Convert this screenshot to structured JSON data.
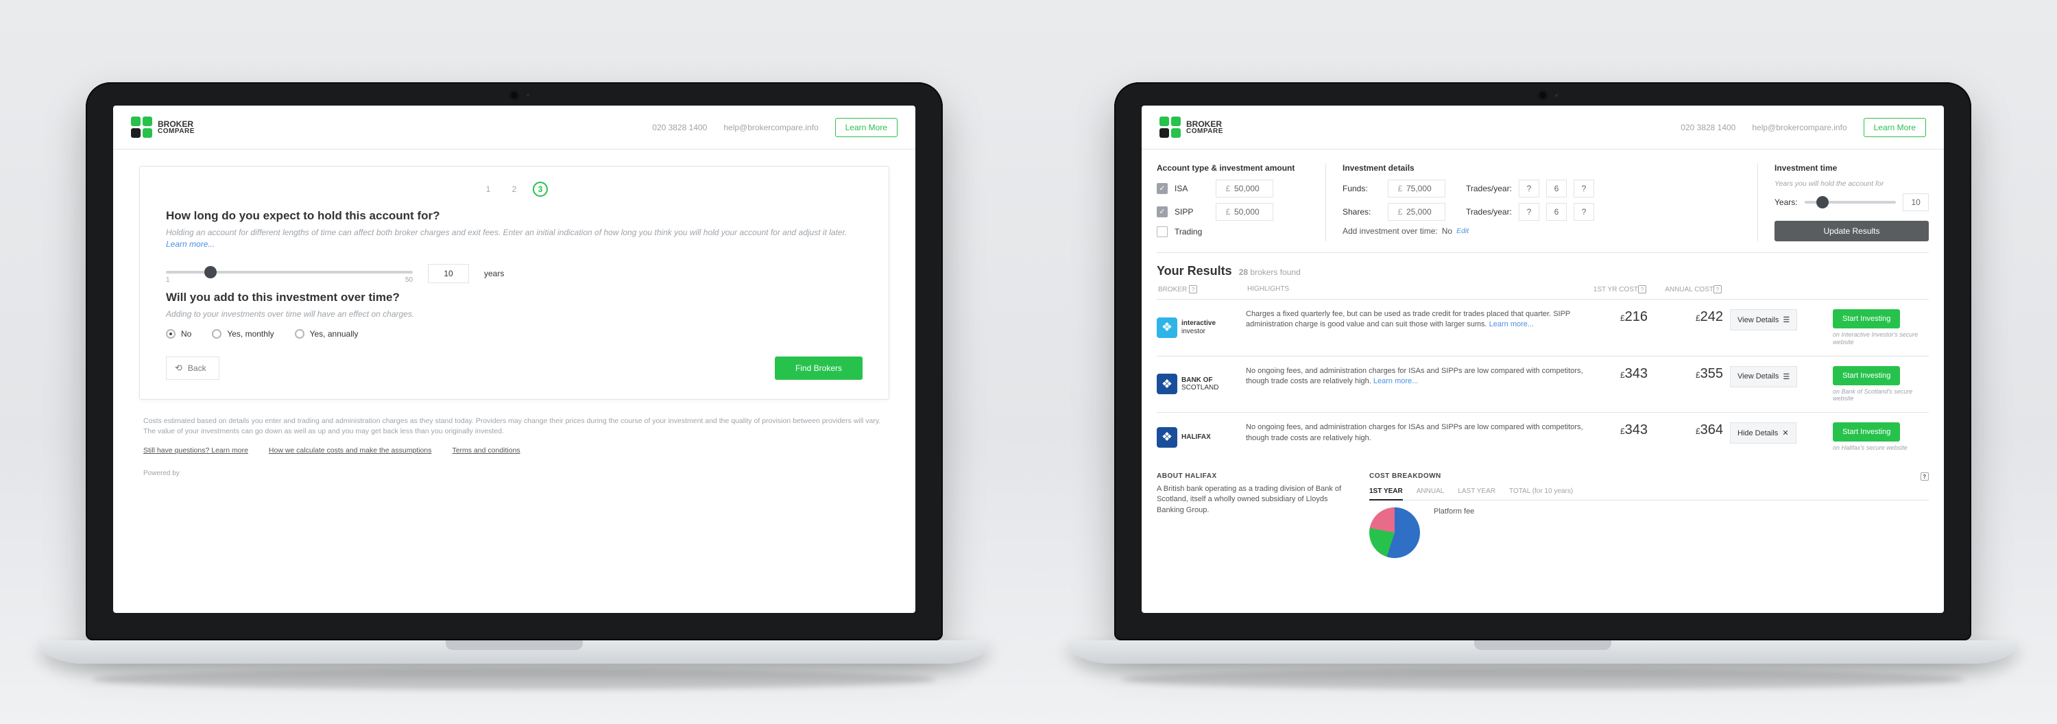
{
  "brand": {
    "line1": "BROKER",
    "line2": "COMPARE"
  },
  "header": {
    "phone": "020 3828 1400",
    "email": "help@brokercompare.info",
    "learn": "Learn More"
  },
  "wizard": {
    "steps": [
      "1",
      "2",
      "3"
    ],
    "active_step": "3",
    "q1_title": "How long do you expect to hold this account for?",
    "q1_sub": "Holding an account for different lengths of time can affect both broker charges and exit fees. Enter an initial indication of how long you think you will hold your account for and adjust it later.",
    "learn_more": "Learn more...",
    "slider_min": "1",
    "slider_max": "50",
    "years_value": "10",
    "years_unit": "years",
    "q2_title": "Will you add to this investment over time?",
    "q2_sub": "Adding to your investments over time will have an effect on charges.",
    "radios": {
      "no": "No",
      "monthly": "Yes, monthly",
      "annually": "Yes, annually",
      "selected": "no"
    },
    "back": "Back",
    "submit": "Find Brokers",
    "disclaimer": "Costs estimated based on details you enter and trading and administration charges as they stand today. Providers may change their prices during the course of your investment and the quality of provision between providers will vary. The value of your investments can go down as well as up and you may get back less than you originally invested.",
    "links": {
      "faq": "Still have questions? Learn more",
      "calc": "How we calculate costs and make the assumptions",
      "terms": "Terms and conditions"
    },
    "powered": "Powered by"
  },
  "filters": {
    "col1_head": "Account type & investment amount",
    "isa_label": "ISA",
    "isa_val": "50,000",
    "sipp_label": "SIPP",
    "sipp_val": "50,000",
    "trading_label": "Trading",
    "currency": "£",
    "col2_head": "Investment details",
    "funds_label": "Funds:",
    "funds_val": "75,000",
    "trades_label": "Trades/year:",
    "funds_t1": "?",
    "funds_t2": "6",
    "funds_t3": "?",
    "shares_label": "Shares:",
    "shares_val": "25,000",
    "shares_t1": "?",
    "shares_t2": "6",
    "shares_t3": "?",
    "add_over_time": "Add investment over time:",
    "add_val": "No",
    "edit": "Edit",
    "col3_head": "Investment time",
    "col3_sub": "Years you will hold the account for",
    "years_label": "Years:",
    "years_val": "10",
    "update": "Update Results"
  },
  "results": {
    "title": "Your Results",
    "count_n": "28",
    "count_label": "brokers found",
    "cols": {
      "broker": "BROKER",
      "high": "HIGHLIGHTS",
      "first": "1ST YR COST",
      "annual": "ANNUAL COST"
    },
    "rows": [
      {
        "name_l1": "interactive",
        "name_l2": "investor",
        "icon_color": "#2fb4e8",
        "blurb": "Charges a fixed quarterly fee, but can be used as trade credit for trades placed that quarter. SIPP administration charge is good value and can suit those with larger sums.",
        "learn": "Learn more...",
        "first": "216",
        "annual": "242",
        "view": "View Details",
        "view_mode": "view",
        "start": "Start Investing",
        "secure": "on Interactive Investor's secure website"
      },
      {
        "name_l1": "BANK OF",
        "name_l2": "SCOTLAND",
        "icon_color": "#1a4e9a",
        "blurb": "No ongoing fees, and administration charges for ISAs and SIPPs are low compared with competitors, though trade costs are relatively high.",
        "learn": "Learn more...",
        "first": "343",
        "annual": "355",
        "view": "View Details",
        "view_mode": "view",
        "start": "Start Investing",
        "secure": "on Bank of Scotland's secure website"
      },
      {
        "name_l1": "HALIFAX",
        "name_l2": "",
        "icon_color": "#1a4e9a",
        "blurb": "No ongoing fees, and administration charges for ISAs and SIPPs are low compared with competitors, though trade costs are relatively high.",
        "learn": "",
        "first": "343",
        "annual": "364",
        "view": "Hide Details",
        "view_mode": "hide",
        "start": "Start Investing",
        "secure": "on Halifax's secure website"
      }
    ],
    "expand": {
      "about_head": "ABOUT HALIFAX",
      "about_body": "A British bank operating as a trading division of Bank of Scotland, itself a wholly owned subsidiary of Lloyds Banking Group.",
      "cost_head": "COST BREAKDOWN",
      "tabs": {
        "t1": "1ST YEAR",
        "t2": "ANNUAL",
        "t3": "LAST YEAR",
        "t4": "TOTAL (for 10 years)"
      },
      "fee1": "Platform fee"
    }
  }
}
